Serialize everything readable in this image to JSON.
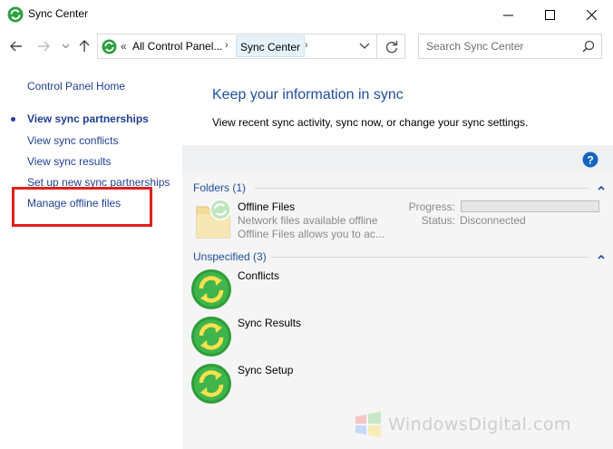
{
  "window": {
    "title": "Sync Center",
    "accent": "#1e4e9d",
    "link_color": "#1f3f94",
    "highlight_color": "#e0201b"
  },
  "address": {
    "overflow": "«",
    "crumb1": "All Control Panel...",
    "crumb2": "Sync Center",
    "search_placeholder": "Search Sync Center"
  },
  "sidebar": {
    "home": "Control Panel Home",
    "items": [
      {
        "label": "View sync partnerships",
        "active": true
      },
      {
        "label": "View sync conflicts"
      },
      {
        "label": "View sync results"
      },
      {
        "label": "Set up new sync partnerships"
      },
      {
        "label": "Manage offline files",
        "highlighted": true
      }
    ]
  },
  "main": {
    "title": "Keep your information in sync",
    "subtitle": "View recent sync activity, sync now, or change your sync settings."
  },
  "groups": {
    "folders": {
      "header": "Folders (1)",
      "items": [
        {
          "title": "Offline Files",
          "line1": "Network files available offline",
          "line2": "Offline Files allows you to ac...",
          "progress_label": "Progress:",
          "progress": 0,
          "status_label": "Status:",
          "status": "Disconnected"
        }
      ]
    },
    "unspecified": {
      "header": "Unspecified (3)",
      "items": [
        {
          "title": "Conflicts"
        },
        {
          "title": "Sync Results"
        },
        {
          "title": "Sync Setup"
        }
      ]
    }
  },
  "watermark": {
    "text": "WindowsDigital.com"
  }
}
